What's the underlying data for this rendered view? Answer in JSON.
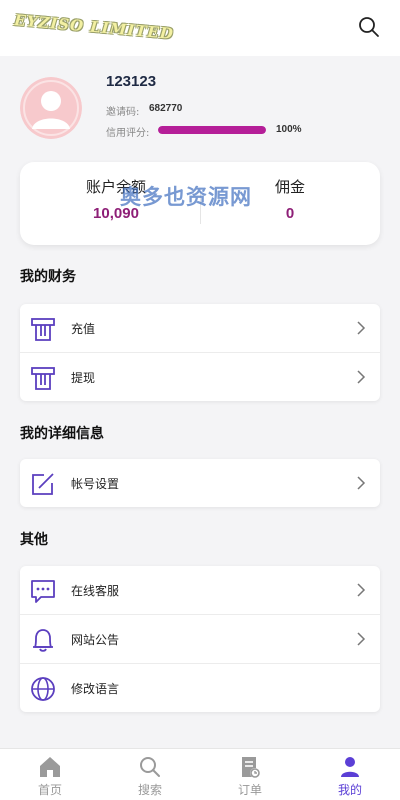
{
  "header": {
    "logo_text": "EYZISO LIMITED",
    "search_icon": "search-icon"
  },
  "profile": {
    "username": "123123",
    "invite_label": "邀请码:",
    "invite_code": "682770",
    "credit_label": "信用评分:",
    "credit_percent": 100,
    "credit_text": "100%",
    "accent": "#b51e98"
  },
  "balance": {
    "balance_label": "账户余额",
    "balance_value": "10,090",
    "commission_label": "佣金",
    "commission_value": "0",
    "value_color": "#8e1f77"
  },
  "watermark": "奥多也资源网",
  "sections": {
    "finance_title": "我的财务",
    "finance_items": [
      {
        "label": "充值",
        "icon": "atm-card-icon"
      },
      {
        "label": "提现",
        "icon": "atm-card-icon"
      }
    ],
    "details_title": "我的详细信息",
    "details_items": [
      {
        "label": "帐号设置",
        "icon": "edit-icon"
      }
    ],
    "other_title": "其他",
    "other_items": [
      {
        "label": "在线客服",
        "icon": "chat-icon"
      },
      {
        "label": "网站公告",
        "icon": "bell-icon"
      },
      {
        "label": "修改语言",
        "icon": "globe-icon"
      }
    ]
  },
  "nav": {
    "items": [
      {
        "label": "首页",
        "icon": "home-icon"
      },
      {
        "label": "搜索",
        "icon": "search-icon"
      },
      {
        "label": "订单",
        "icon": "order-icon"
      },
      {
        "label": "我的",
        "icon": "user-icon"
      }
    ],
    "active_index": 3,
    "active_color": "#5b3fd6"
  }
}
